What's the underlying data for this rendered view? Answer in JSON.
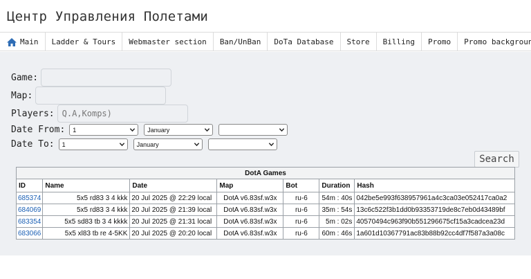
{
  "header": {
    "title": "Центр Управления Полетами"
  },
  "nav": {
    "items": [
      {
        "label": "Main",
        "icon": "home-icon"
      },
      {
        "label": "Ladder & Tours"
      },
      {
        "label": "Webmaster section"
      },
      {
        "label": "Ban/UnBan"
      },
      {
        "label": "DoTa Database"
      },
      {
        "label": "Store"
      },
      {
        "label": "Billing"
      },
      {
        "label": "Promo"
      },
      {
        "label": "Promo background"
      }
    ]
  },
  "form": {
    "game_label": "Game:",
    "game_value": "",
    "map_label": "Map:",
    "map_value": "",
    "players_label": "Players:",
    "players_placeholder": "Q.A,Komps)",
    "date_from_label": "Date From:",
    "date_from": {
      "day": "1",
      "month": "January",
      "year": ""
    },
    "date_to_label": "Date To:",
    "date_to": {
      "day": "1",
      "month": "January",
      "year": ""
    },
    "search_label": "Search"
  },
  "table": {
    "caption": "DotA Games",
    "columns": [
      "ID",
      "Name",
      "Date",
      "Map",
      "Bot",
      "Duration",
      "Hash"
    ],
    "rows": [
      {
        "id": "685374",
        "name": "5x5 rd83 3 4 kkk",
        "date": "20 Jul 2025 @ 22:29 local",
        "map": "DotA v6.83sf.w3x",
        "bot": "ru-6",
        "duration": "54m : 40s",
        "hash": "042be5e993f638957961a4c3ca03e052417ca0a2"
      },
      {
        "id": "684069",
        "name": "5x5 rd83 3 4 kkk",
        "date": "20 Jul 2025 @ 21:39 local",
        "map": "DotA v6.83sf.w3x",
        "bot": "ru-6",
        "duration": "35m : 54s",
        "hash": "13c6c522f3b1dd0b93353719de8c7eb0d43489bf"
      },
      {
        "id": "683354",
        "name": "5x5 sd83 tb 3 4 kkkk",
        "date": "20 Jul 2025 @ 21:31 local",
        "map": "DotA v6.83sf.w3x",
        "bot": "ru-6",
        "duration": "5m : 02s",
        "hash": "40570494c963f90b551296675cf15a3cadcea23d"
      },
      {
        "id": "683066",
        "name": "5x5 xl83 tb re 4-5KK",
        "date": "20 Jul 2025 @ 20:20 local",
        "map": "DotA v6.83sf.w3x",
        "bot": "ru-6",
        "duration": "60m : 46s",
        "hash": "1a601d10367791ac83b88b92cc4df7f587a3a08c"
      }
    ]
  },
  "colors": {
    "accent": "#1a5fb4",
    "panel_bg": "#eef0f3"
  }
}
